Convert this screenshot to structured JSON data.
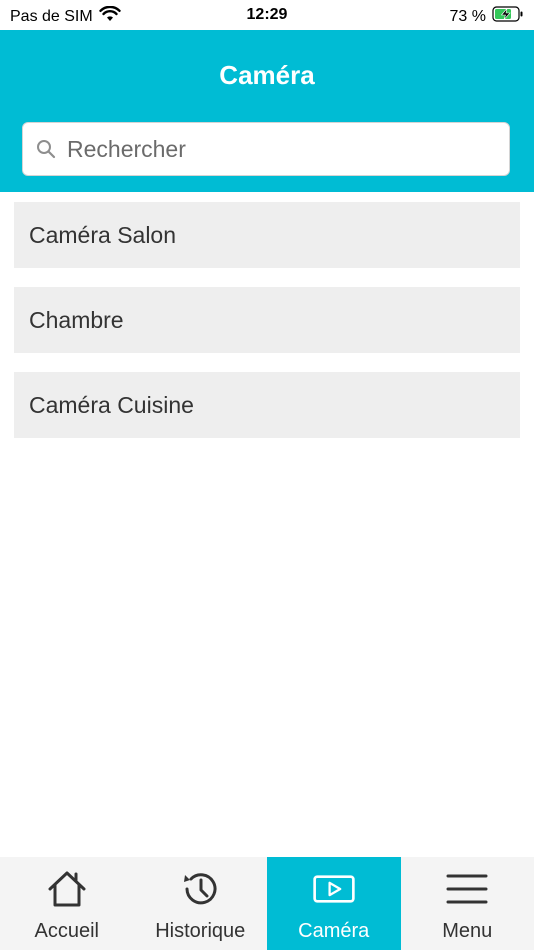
{
  "status_bar": {
    "carrier": "Pas de SIM",
    "time": "12:29",
    "battery": "73 %",
    "icons": [
      "wifi-icon",
      "battery-charging-icon"
    ]
  },
  "header": {
    "title": "Caméra",
    "background_color": "#00bcd4"
  },
  "search": {
    "placeholder": "Rechercher",
    "value": ""
  },
  "cameras": [
    {
      "label": "Caméra Salon"
    },
    {
      "label": "Chambre"
    },
    {
      "label": "Caméra Cuisine"
    }
  ],
  "tab_bar": {
    "tabs": [
      {
        "label": "Accueil",
        "icon": "home-icon",
        "active": false
      },
      {
        "label": "Historique",
        "icon": "history-icon",
        "active": false
      },
      {
        "label": "Caméra",
        "icon": "video-play-icon",
        "active": true
      },
      {
        "label": "Menu",
        "icon": "hamburger-menu-icon",
        "active": false
      }
    ],
    "active_color": "#00bcd4"
  }
}
